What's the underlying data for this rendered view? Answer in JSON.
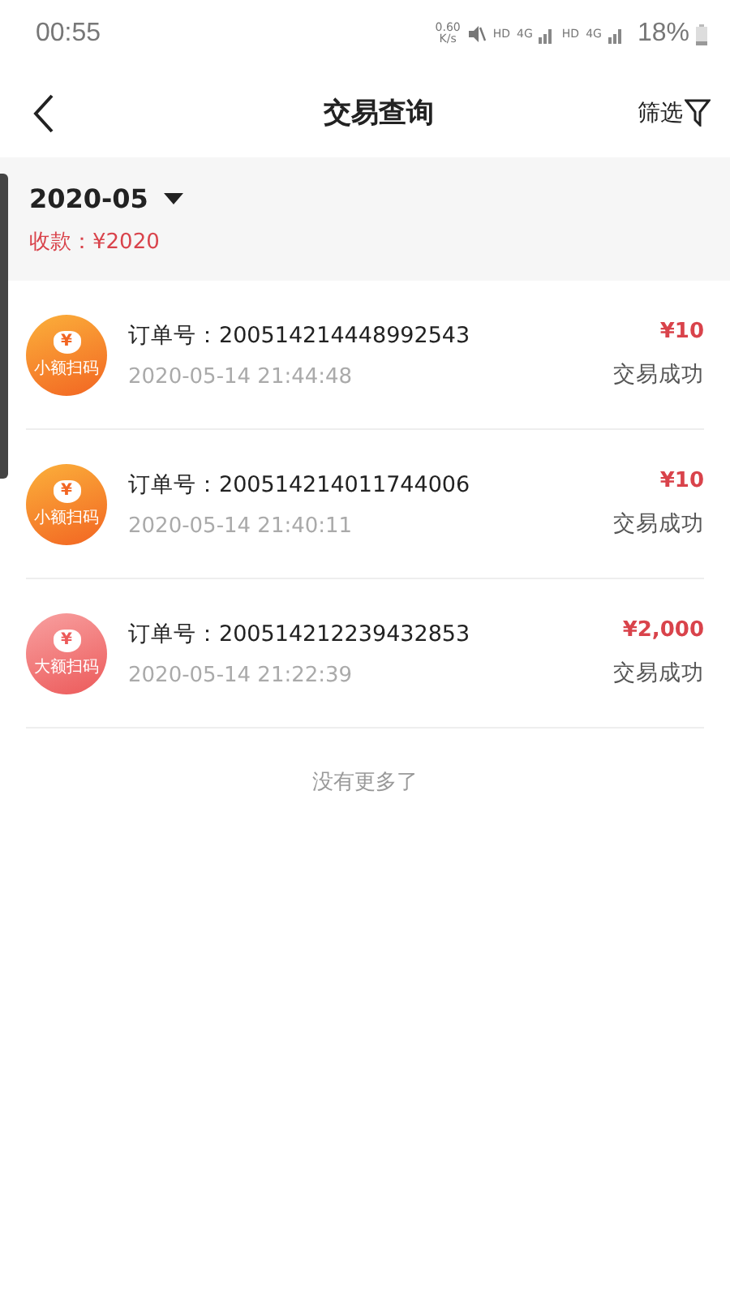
{
  "status_bar": {
    "time": "00:55",
    "speed": "0.60",
    "speed_unit": "K/s",
    "hd_1": "HD",
    "net_1": "4G",
    "hd_2": "HD",
    "net_2": "4G",
    "battery": "18%"
  },
  "nav": {
    "title": "交易查询",
    "filter": "筛选"
  },
  "month": {
    "label": "2020-05",
    "summary": "收款：¥2020"
  },
  "transactions": [
    {
      "kind": "small",
      "icon_glyph": "¥",
      "icon_label": "小额扫码",
      "order": "订单号：200514214448992543",
      "time": "2020-05-14 21:44:48",
      "amount": "¥10",
      "status": "交易成功"
    },
    {
      "kind": "small",
      "icon_glyph": "¥",
      "icon_label": "小额扫码",
      "order": "订单号：200514214011744006",
      "time": "2020-05-14 21:40:11",
      "amount": "¥10",
      "status": "交易成功"
    },
    {
      "kind": "large",
      "icon_glyph": "¥",
      "icon_label": "大额扫码",
      "order": "订单号：200514212239432853",
      "time": "2020-05-14 21:22:39",
      "amount": "¥2,000",
      "status": "交易成功"
    }
  ],
  "footer": "没有更多了"
}
